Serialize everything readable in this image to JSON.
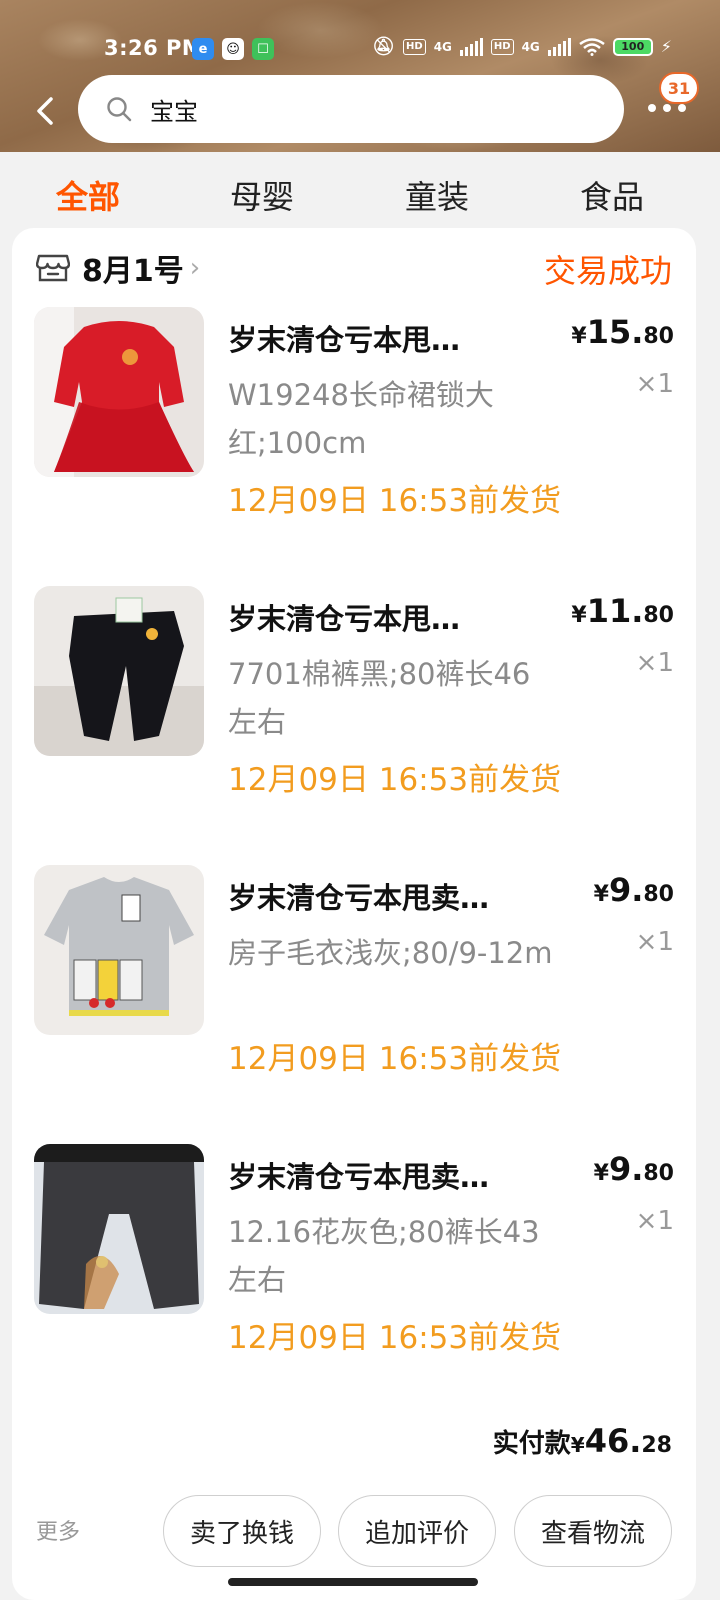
{
  "status_bar": {
    "time": "3:26 PM",
    "network_1": "4G",
    "network_2": "4G",
    "hd": "HD",
    "battery": "100"
  },
  "search": {
    "query": "宝宝",
    "badge_count": "31"
  },
  "tabs": [
    {
      "label": "全部",
      "active": true
    },
    {
      "label": "母婴",
      "active": false
    },
    {
      "label": "童装",
      "active": false
    },
    {
      "label": "食品",
      "active": false
    }
  ],
  "order": {
    "shop_name": "8月1号",
    "status": "交易成功",
    "items": [
      {
        "title": "岁末清仓亏本甩…",
        "spec": "W19248长命裙锁大红;100cm",
        "ship": "12月09日 16:53前发货",
        "price_symbol": "¥",
        "price_int": "15.",
        "price_dec": "80",
        "qty": "×1"
      },
      {
        "title": "岁末清仓亏本甩…",
        "spec": "7701棉裤黑;80裤长46左右",
        "ship": "12月09日 16:53前发货",
        "price_symbol": "¥",
        "price_int": "11.",
        "price_dec": "80",
        "qty": "×1"
      },
      {
        "title": "岁末清仓亏本甩卖…",
        "spec": "房子毛衣浅灰;80/9-12m",
        "ship": "12月09日 16:53前发货",
        "price_symbol": "¥",
        "price_int": "9.",
        "price_dec": "80",
        "qty": "×1"
      },
      {
        "title": "岁末清仓亏本甩卖…",
        "spec": "12.16花灰色;80裤长43左右",
        "ship": "12月09日 16:53前发货",
        "price_symbol": "¥",
        "price_int": "9.",
        "price_dec": "80",
        "qty": "×1"
      }
    ],
    "total": {
      "label": "实付款",
      "symbol": "¥",
      "int": "46.",
      "dec": "28"
    },
    "more_label": "更多",
    "actions": [
      "卖了换钱",
      "追加评价",
      "查看物流"
    ]
  },
  "colors": {
    "accent": "#ff5500",
    "ship_text": "#f29c1f",
    "spec_text": "#8a8a8a"
  }
}
